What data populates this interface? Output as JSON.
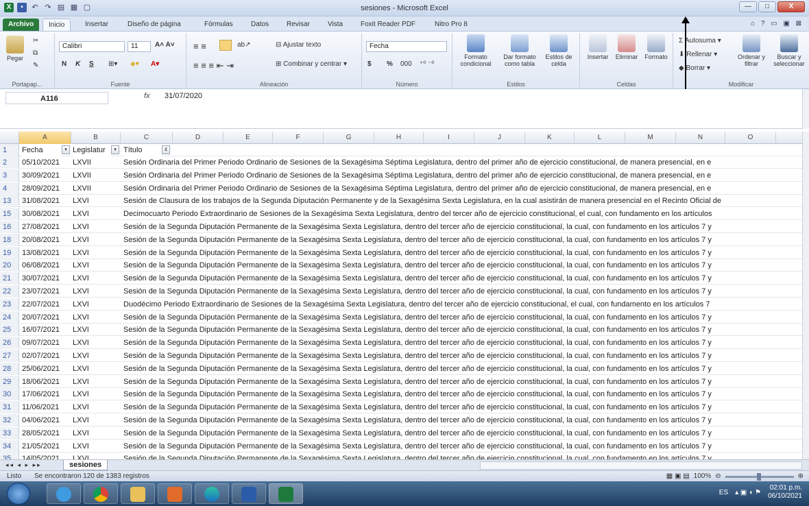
{
  "window": {
    "title": "sesiones - Microsoft Excel",
    "controls": [
      "—",
      "□",
      "X"
    ]
  },
  "ribbon": {
    "tabs": [
      "Archivo",
      "Inicio",
      "Insertar",
      "Diseño de página",
      "Fórmulas",
      "Datos",
      "Revisar",
      "Vista",
      "Foxit Reader PDF",
      "Nitro Pro 8"
    ],
    "active_tab": "Inicio",
    "clipboard": {
      "paste": "Pegar",
      "label": "Portapap..."
    },
    "font": {
      "name": "Calibri",
      "size": "11",
      "label": "Fuente",
      "bold": "N",
      "italic": "K",
      "underline": "S"
    },
    "alignment": {
      "wrap": "Ajustar texto",
      "merge": "Combinar y centrar",
      "label": "Alineación"
    },
    "number": {
      "format": "Fecha",
      "currency": "$",
      "percent": "%",
      "thousands": "000",
      "label": "Número"
    },
    "styles": {
      "conditional": "Formato condicional",
      "as_table": "Dar formato como tabla",
      "cell_styles": "Estilos de celda",
      "label": "Estilos"
    },
    "cells": {
      "insert": "Insertar",
      "delete": "Eliminar",
      "format": "Formato",
      "label": "Celdas"
    },
    "editing": {
      "autosum": "Autosuma",
      "fill": "Rellenar",
      "clear": "Borrar",
      "sort": "Ordenar y filtrar",
      "find": "Buscar y seleccionar",
      "label": "Modificar"
    }
  },
  "formula_bar": {
    "cell_ref": "A116",
    "fx": "fx",
    "value": "31/07/2020"
  },
  "columns": [
    "A",
    "B",
    "C",
    "D",
    "E",
    "F",
    "G",
    "H",
    "I",
    "J",
    "K",
    "L",
    "M",
    "N",
    "O"
  ],
  "header": {
    "row": "1",
    "fecha": "Fecha",
    "legislatura": "Legislatur",
    "titulo": "Título"
  },
  "rows": [
    {
      "n": "2",
      "fecha": "05/10/2021",
      "leg": "LXVII",
      "titulo": "Sesión Ordinaria del Primer Periodo Ordinario de Sesiones de la Sexagésima Séptima Legislatura, dentro del primer año de ejercicio constitucional, de manera presencial, en e"
    },
    {
      "n": "3",
      "fecha": "30/09/2021",
      "leg": "LXVII",
      "titulo": "Sesión Ordinaria del Primer Periodo Ordinario de Sesiones de la Sexagésima Séptima Legislatura, dentro del primer año de ejercicio constitucional, de manera presencial, en e"
    },
    {
      "n": "4",
      "fecha": "28/09/2021",
      "leg": "LXVII",
      "titulo": "Sesión Ordinaria del Primer Periodo Ordinario de Sesiones de la Sexagésima Séptima Legislatura, dentro del primer año de ejercicio constitucional, de manera presencial, en e"
    },
    {
      "n": "13",
      "fecha": "31/08/2021",
      "leg": "LXVI",
      "titulo": "Sesión de Clausura de los trabajos de la Segunda Diputación Permanente y de la Sexagésima Sexta Legislatura, en la cual asistirán de manera presencial en el Recinto Oficial de"
    },
    {
      "n": "15",
      "fecha": "30/08/2021",
      "leg": "LXVI",
      "titulo": "Decimocuarto Periodo Extraordinario de Sesiones de la Sexagésima Sexta Legislatura, dentro del tercer año de ejercicio constitucional, el cual, con fundamento en los artículos"
    },
    {
      "n": "16",
      "fecha": "27/08/2021",
      "leg": "LXVI",
      "titulo": "Sesión de la Segunda Diputación Permanente de la Sexagésima Sexta Legislatura, dentro del tercer año de ejercicio constitucional, la cual, con fundamento en los artículos 7 y"
    },
    {
      "n": "18",
      "fecha": "20/08/2021",
      "leg": "LXVI",
      "titulo": "Sesión de la Segunda Diputación Permanente de la Sexagésima Sexta Legislatura, dentro del tercer año de ejercicio constitucional, la cual, con fundamento en los artículos 7 y"
    },
    {
      "n": "19",
      "fecha": "13/08/2021",
      "leg": "LXVI",
      "titulo": "Sesión de la Segunda Diputación Permanente de la Sexagésima Sexta Legislatura, dentro del tercer año de ejercicio constitucional, la cual, con fundamento en los artículos 7 y"
    },
    {
      "n": "20",
      "fecha": "06/08/2021",
      "leg": "LXVI",
      "titulo": "Sesión de la Segunda Diputación Permanente de la Sexagésima Sexta Legislatura, dentro del tercer año de ejercicio constitucional, la cual, con fundamento en los artículos 7 y"
    },
    {
      "n": "21",
      "fecha": "30/07/2021",
      "leg": "LXVI",
      "titulo": "Sesión de la Segunda Diputación Permanente de la Sexagésima Sexta Legislatura, dentro del tercer año de ejercicio constitucional, la cual, con fundamento en los artículos 7 y"
    },
    {
      "n": "22",
      "fecha": "23/07/2021",
      "leg": "LXVI",
      "titulo": "Sesión de la Segunda Diputación Permanente de la Sexagésima Sexta Legislatura, dentro del tercer año de ejercicio constitucional, la cual, con fundamento en los artículos 7 y"
    },
    {
      "n": "23",
      "fecha": "22/07/2021",
      "leg": "LXVI",
      "titulo": "Duodécimo Periodo Extraordinario de Sesiones de la Sexagésima Sexta Legislatura, dentro del tercer año de ejercicio constitucional, el cual, con fundamento en los artículos 7"
    },
    {
      "n": "24",
      "fecha": "20/07/2021",
      "leg": "LXVI",
      "titulo": "Sesión de la Segunda Diputación Permanente de la Sexagésima Sexta Legislatura, dentro del tercer año de ejercicio constitucional, la cual, con fundamento en los artículos 7 y"
    },
    {
      "n": "25",
      "fecha": "16/07/2021",
      "leg": "LXVI",
      "titulo": "Sesión de la Segunda Diputación Permanente de la Sexagésima Sexta Legislatura, dentro del tercer año de ejercicio constitucional, la cual, con fundamento en los artículos 7 y"
    },
    {
      "n": "26",
      "fecha": "09/07/2021",
      "leg": "LXVI",
      "titulo": "Sesión de la Segunda Diputación Permanente de la Sexagésima Sexta Legislatura, dentro del tercer año de ejercicio constitucional, la cual, con fundamento en los artículos 7 y"
    },
    {
      "n": "27",
      "fecha": "02/07/2021",
      "leg": "LXVI",
      "titulo": "Sesión de la Segunda Diputación Permanente de la Sexagésima Sexta Legislatura, dentro del tercer año de ejercicio constitucional, la cual, con fundamento en los artículos 7 y"
    },
    {
      "n": "28",
      "fecha": "25/06/2021",
      "leg": "LXVI",
      "titulo": "Sesión de la Segunda Diputación Permanente de la Sexagésima Sexta Legislatura, dentro del tercer año de ejercicio constitucional, la cual, con fundamento en los artículos 7 y"
    },
    {
      "n": "29",
      "fecha": "18/06/2021",
      "leg": "LXVI",
      "titulo": "Sesión de la Segunda Diputación Permanente de la Sexagésima Sexta Legislatura, dentro del tercer año de ejercicio constitucional, la cual, con fundamento en los artículos 7 y"
    },
    {
      "n": "30",
      "fecha": "17/06/2021",
      "leg": "LXVI",
      "titulo": "Sesión de la Segunda Diputación Permanente de la Sexagésima Sexta Legislatura, dentro del tercer año de ejercicio constitucional, la cual, con fundamento en los artículos 7 y"
    },
    {
      "n": "31",
      "fecha": "11/06/2021",
      "leg": "LXVI",
      "titulo": "Sesión de la Segunda Diputación Permanente de la Sexagésima Sexta Legislatura, dentro del tercer año de ejercicio constitucional, la cual, con fundamento en los artículos 7 y"
    },
    {
      "n": "32",
      "fecha": "04/06/2021",
      "leg": "LXVI",
      "titulo": "Sesión de la Segunda Diputación Permanente de la Sexagésima Sexta Legislatura, dentro del tercer año de ejercicio constitucional, la cual, con fundamento en los artículos 7 y"
    },
    {
      "n": "33",
      "fecha": "28/05/2021",
      "leg": "LXVI",
      "titulo": "Sesión de la Segunda Diputación Permanente de la Sexagésima Sexta Legislatura, dentro del tercer año de ejercicio constitucional, la cual, con fundamento en los artículos 7 y"
    },
    {
      "n": "34",
      "fecha": "21/05/2021",
      "leg": "LXVI",
      "titulo": "Sesión de la Segunda Diputación Permanente de la Sexagésima Sexta Legislatura, dentro del tercer año de ejercicio constitucional, la cual, con fundamento en los artículos 7 y"
    },
    {
      "n": "35",
      "fecha": "14/05/2021",
      "leg": "LXVI",
      "titulo": "Sesión de la Segunda Diputación Permanente de la Sexagésima Sexta Legislatura, dentro del tercer año de ejercicio constitucional, la cual, con fundamento en los artículos 7 y"
    }
  ],
  "sheet_tab": "sesiones",
  "status": {
    "mode": "Listo",
    "message": "Se encontraron 120 de 1383 registros",
    "zoom": "100%"
  },
  "taskbar": {
    "lang": "ES",
    "time": "02:01 p.m.",
    "date": "06/10/2021"
  },
  "colors": {
    "excel_green": "#1e7a3c",
    "selection": "#f2c86a",
    "row_number": "#3a5da8"
  }
}
